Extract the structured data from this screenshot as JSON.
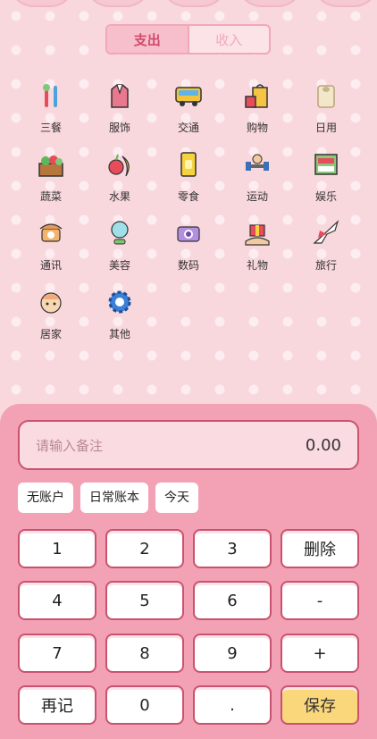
{
  "tabs": {
    "expense": "支出",
    "income": "收入"
  },
  "categories": [
    {
      "label": "三餐",
      "icon": "utensils-icon"
    },
    {
      "label": "服饰",
      "icon": "clothing-icon"
    },
    {
      "label": "交通",
      "icon": "bus-icon"
    },
    {
      "label": "购物",
      "icon": "shopping-bag-icon"
    },
    {
      "label": "日用",
      "icon": "toilet-paper-icon"
    },
    {
      "label": "蔬菜",
      "icon": "vegetable-basket-icon"
    },
    {
      "label": "水果",
      "icon": "fruit-icon"
    },
    {
      "label": "零食",
      "icon": "snack-icon"
    },
    {
      "label": "运动",
      "icon": "dumbbell-icon"
    },
    {
      "label": "娱乐",
      "icon": "entertainment-icon"
    },
    {
      "label": "通讯",
      "icon": "telephone-icon"
    },
    {
      "label": "美容",
      "icon": "mirror-icon"
    },
    {
      "label": "数码",
      "icon": "camera-icon"
    },
    {
      "label": "礼物",
      "icon": "gift-icon"
    },
    {
      "label": "旅行",
      "icon": "airplane-icon"
    },
    {
      "label": "居家",
      "icon": "home-face-icon"
    },
    {
      "label": "其他",
      "icon": "gear-icon"
    }
  ],
  "note": {
    "placeholder": "请输入备注",
    "amount": "0.00"
  },
  "chips": {
    "account": "无账户",
    "book": "日常账本",
    "date": "今天"
  },
  "keypad": {
    "k1": "1",
    "k2": "2",
    "k3": "3",
    "del": "删除",
    "k4": "4",
    "k5": "5",
    "k6": "6",
    "minus": "-",
    "k7": "7",
    "k8": "8",
    "k9": "9",
    "plus": "+",
    "again": "再记",
    "k0": "0",
    "dot": ".",
    "save": "保存"
  }
}
